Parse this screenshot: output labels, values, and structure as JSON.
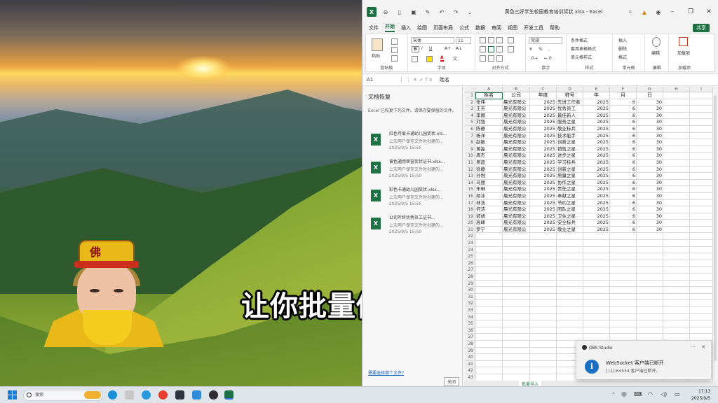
{
  "subtitle": "让你批量做奖状",
  "webcam": {
    "hat_text": "佛"
  },
  "excel": {
    "title": "黄色三好学生校园教育培训奖状.xlsx - Excel",
    "menu": [
      "文件",
      "开始",
      "插入",
      "绘图",
      "页面布局",
      "公式",
      "数据",
      "审阅",
      "视图",
      "开发工具",
      "帮助"
    ],
    "active_menu": "开始",
    "share_label": "共享",
    "ribbon": {
      "groups": [
        "剪贴板",
        "字体",
        "对齐方式",
        "数字",
        "样式",
        "单元格",
        "编辑",
        "加载项"
      ],
      "paste_label": "粘贴",
      "font_name": "宋体",
      "font_size": "11",
      "number_format": "常规",
      "cond_format": "条件格式",
      "table_format": "套用表格格式",
      "cell_style": "单元格样式",
      "insert": "插入",
      "delete": "删除",
      "format": "格式",
      "edit": "编辑",
      "addin": "加载项"
    },
    "namebox": "A1",
    "formula_value": "姓名",
    "recovery": {
      "title": "文档恢复",
      "desc": "Excel 已恢复下列文件。请保存要保留的文件。",
      "items": [
        {
          "name": "红色可爱卡通幼儿园奖状.xls...",
          "sub": "上次用户保存文件时创建的...",
          "date": "2025/9/5 15:55"
        },
        {
          "name": "黄色通用荣誉奖状证书.xlsx...",
          "sub": "上次用户保存文件时创建的...",
          "date": "2025/9/5 15:50"
        },
        {
          "name": "彩色卡通幼儿园奖状.xlsx...",
          "sub": "上次用户保存文件时创建的...",
          "date": "2025/9/5 15:55"
        },
        {
          "name": "公司年终优秀员工证书...",
          "sub": "上次用户保存文件时创建的...",
          "date": "2025/9/5 15:50"
        }
      ],
      "link": "需要选择哪个文件?",
      "close": "关闭"
    },
    "columns": [
      "A",
      "B",
      "C",
      "D",
      "E",
      "F",
      "G",
      "H",
      "I"
    ],
    "headers": [
      "姓名",
      "公司",
      "年度",
      "称号",
      "年",
      "月",
      "日"
    ],
    "rows": [
      [
        "张伟",
        "晨光有限公",
        "2025",
        "先进工作者",
        "2025",
        "6",
        "30"
      ],
      [
        "王芳",
        "晨光有限公",
        "2025",
        "优秀员工",
        "2025",
        "6",
        "30"
      ],
      [
        "李娜",
        "晨光有限公",
        "2025",
        "最佳新人",
        "2025",
        "6",
        "30"
      ],
      [
        "刘强",
        "晨光有限公",
        "2025",
        "服务之星",
        "2025",
        "6",
        "30"
      ],
      [
        "陈静",
        "晨光有限公",
        "2025",
        "敬业标兵",
        "2025",
        "6",
        "30"
      ],
      [
        "杨洋",
        "晨光有限公",
        "2025",
        "技术能手",
        "2025",
        "6",
        "30"
      ],
      [
        "赵敏",
        "晨光有限公",
        "2025",
        "创新之星",
        "2025",
        "6",
        "30"
      ],
      [
        "黄磊",
        "晨光有限公",
        "2025",
        "销售之星",
        "2025",
        "6",
        "30"
      ],
      [
        "周杰",
        "晨光有限公",
        "2025",
        "进步之星",
        "2025",
        "6",
        "30"
      ],
      [
        "吴超",
        "晨光有限公",
        "2025",
        "学习标兵",
        "2025",
        "6",
        "30"
      ],
      [
        "徐静",
        "晨光有限公",
        "2025",
        "创新之星",
        "2025",
        "6",
        "30"
      ],
      [
        "孙悦",
        "晨光有限公",
        "2025",
        "质量之星",
        "2025",
        "6",
        "30"
      ],
      [
        "马丽",
        "晨光有限公",
        "2025",
        "协作之星",
        "2025",
        "6",
        "30"
      ],
      [
        "朱琳",
        "晨光有限公",
        "2025",
        "责任之星",
        "2025",
        "6",
        "30"
      ],
      [
        "胡冰",
        "晨光有限公",
        "2025",
        "奉献之星",
        "2025",
        "6",
        "30"
      ],
      [
        "林浩",
        "晨光有限公",
        "2025",
        "节约之星",
        "2025",
        "6",
        "30"
      ],
      [
        "何洁",
        "晨光有限公",
        "2025",
        "团队之星",
        "2025",
        "6",
        "30"
      ],
      [
        "郭靖",
        "晨光有限公",
        "2025",
        "卫生之星",
        "2025",
        "6",
        "30"
      ],
      [
        "高峰",
        "晨光有限公",
        "2025",
        "安全标兵",
        "2025",
        "6",
        "30"
      ],
      [
        "罗宁",
        "晨光有限公",
        "2025",
        "敬业之星",
        "2025",
        "6",
        "30"
      ]
    ],
    "empty_row_numbers": [
      "22",
      "23",
      "24",
      "25",
      "26",
      "27",
      "28",
      "29",
      "30",
      "31",
      "32",
      "33",
      "34",
      "35",
      "36",
      "37",
      "38",
      "39",
      "40",
      "41",
      "42",
      "43"
    ],
    "sheet_tab": "批量导入"
  },
  "toast": {
    "app": "OBS Studio",
    "title": "WebSocket 客户端已断开",
    "body": "[::1]:64534 客户端已断开。",
    "more": "···",
    "close": "✕"
  },
  "taskbar": {
    "search_placeholder": "搜索",
    "time": "17:13",
    "date": "2025/9/5"
  }
}
